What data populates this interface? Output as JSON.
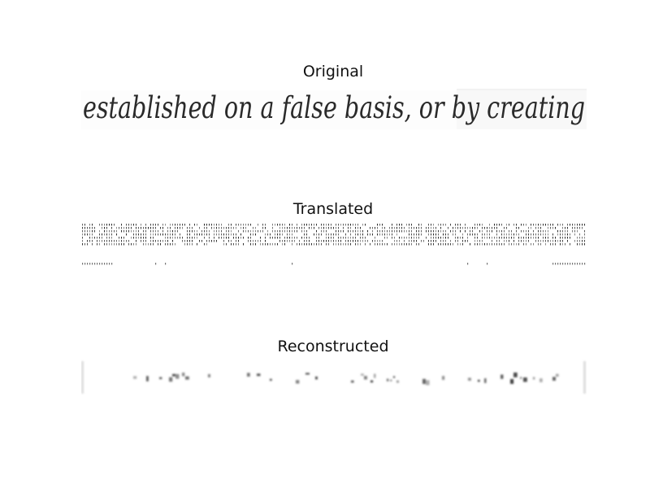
{
  "figure": {
    "panels": [
      {
        "title": "Original",
        "handwriting_text": "established on a false basis, or by creating"
      },
      {
        "title": "Translated"
      },
      {
        "title": "Reconstructed"
      }
    ]
  }
}
